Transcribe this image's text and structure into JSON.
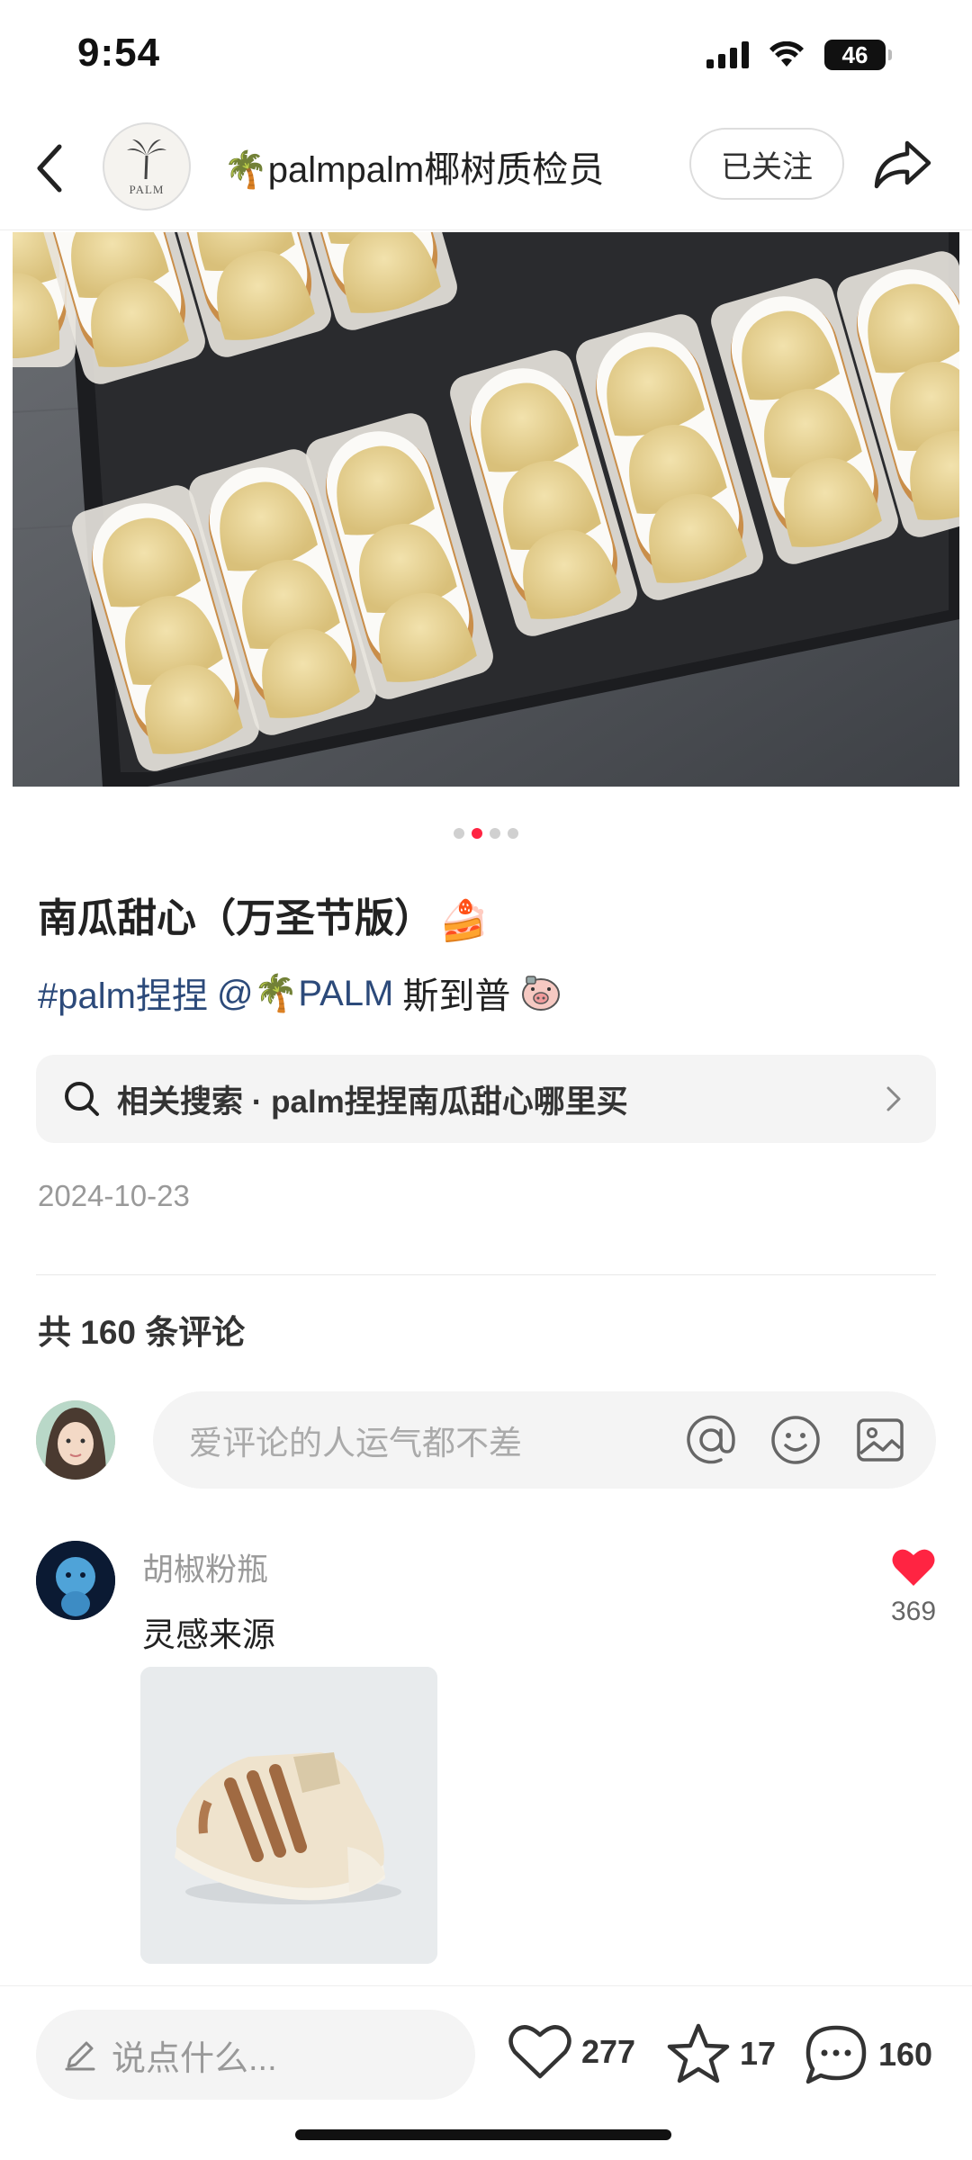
{
  "status_bar": {
    "time": "9:54",
    "battery": "46"
  },
  "header": {
    "author_name": "🌴palmpalm椰树质检员",
    "follow_label": "已关注",
    "avatar_text": "PALM"
  },
  "carousel": {
    "count": 4,
    "active": 1
  },
  "post": {
    "title": "南瓜甜心（万圣节版）",
    "title_emoji": "🍰",
    "tag": "#palm捏捏",
    "mention": "@🌴PALM",
    "tag_text": "斯到普",
    "related_search": "相关搜索 · palm捏捏南瓜甜心哪里买",
    "date": "2024-10-23"
  },
  "comments": {
    "count_label": "共 160 条评论",
    "input_placeholder": "爱评论的人运气都不差",
    "items": [
      {
        "user": "胡椒粉瓶",
        "text": "灵感来源",
        "likes": "369"
      }
    ]
  },
  "bottom_bar": {
    "say_placeholder": "说点什么...",
    "likes": "277",
    "favorites": "17",
    "comments": "160"
  },
  "colors": {
    "accent": "#ff2442",
    "tag": "#2c4a7a"
  }
}
